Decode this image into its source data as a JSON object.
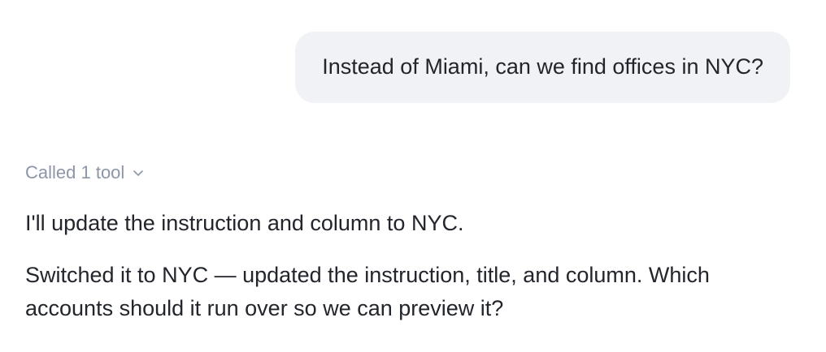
{
  "user_message": {
    "text": "Instead of Miami, can we find offices in NYC?"
  },
  "assistant": {
    "tool_summary": {
      "label": "Called 1 tool",
      "icon": "chevron-down-icon"
    },
    "paragraphs": [
      "I'll update the instruction and column to NYC.",
      "Switched it to NYC — updated the instruction, title, and column. Which accounts should it run over so we can preview it?"
    ]
  },
  "colors": {
    "bubble_bg": "#f1f2f6",
    "text": "#22252b",
    "muted": "#8c96a7"
  }
}
